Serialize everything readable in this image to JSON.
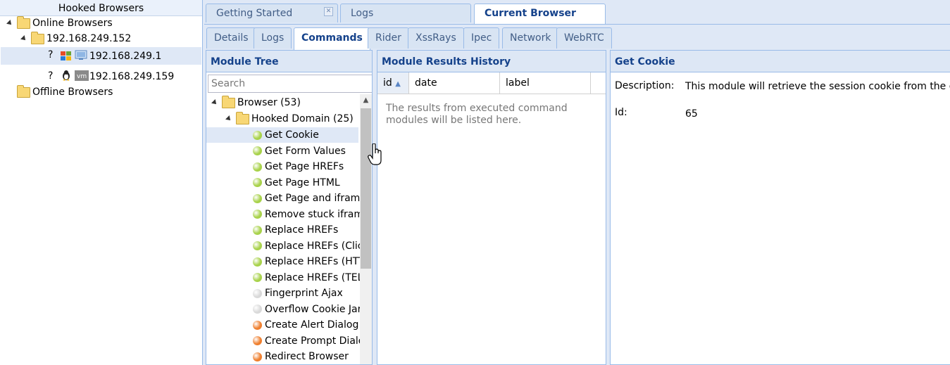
{
  "left_panel": {
    "title": "Hooked Browsers",
    "online_label": "Online Browsers",
    "host_ip": "192.168.249.152",
    "browsers": [
      {
        "q": "?",
        "ip": "192.168.249.1"
      },
      {
        "q": "?",
        "ip": "192.168.249.159"
      }
    ],
    "offline_label": "Offline Browsers"
  },
  "tabs": [
    {
      "label": "Getting Started"
    },
    {
      "label": "Logs"
    },
    {
      "label": "Current Browser"
    }
  ],
  "subtabs": [
    "Details",
    "Logs",
    "Commands",
    "Rider",
    "XssRays",
    "Ipec",
    "Network",
    "WebRTC"
  ],
  "module_tree": {
    "title": "Module Tree",
    "search_placeholder": "Search",
    "category": "Browser (53)",
    "subcategory": "Hooked Domain (25)",
    "modules": [
      {
        "label": "Get Cookie",
        "color": "#a8d24a"
      },
      {
        "label": "Get Form Values",
        "color": "#a8d24a"
      },
      {
        "label": "Get Page HREFs",
        "color": "#a8d24a"
      },
      {
        "label": "Get Page HTML",
        "color": "#a8d24a"
      },
      {
        "label": "Get Page and iframe",
        "color": "#a8d24a"
      },
      {
        "label": "Remove stuck iframe",
        "color": "#a8d24a"
      },
      {
        "label": "Replace HREFs",
        "color": "#a8d24a"
      },
      {
        "label": "Replace HREFs (Click",
        "color": "#a8d24a"
      },
      {
        "label": "Replace HREFs (HTT",
        "color": "#a8d24a"
      },
      {
        "label": "Replace HREFs (TEL",
        "color": "#a8d24a"
      },
      {
        "label": "Fingerprint Ajax",
        "color": "#d9d9d9"
      },
      {
        "label": "Overflow Cookie Jar",
        "color": "#d9d9d9"
      },
      {
        "label": "Create Alert Dialog",
        "color": "#ef7f2e"
      },
      {
        "label": "Create Prompt Dialog",
        "color": "#ef7f2e"
      },
      {
        "label": "Redirect Browser",
        "color": "#ef7f2e"
      }
    ]
  },
  "results_history": {
    "title": "Module Results History",
    "columns": [
      "id",
      "date",
      "label"
    ],
    "empty_message": "The results from executed command modules will be listed here."
  },
  "module_detail": {
    "title": "Get Cookie",
    "description_label": "Description:",
    "description_value": "This module will retrieve the session cookie from the current pa",
    "id_label": "Id:",
    "id_value": "65"
  }
}
